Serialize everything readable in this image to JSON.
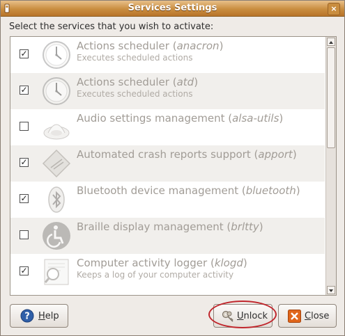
{
  "window": {
    "title": "Services Settings",
    "close_glyph": "×"
  },
  "prompt": "Select the services that you wish to activate:",
  "services": [
    {
      "name": "Actions scheduler (",
      "pkg": "anacron",
      "tail": ")",
      "desc": "Executes scheduled actions",
      "checked": true,
      "icon": "clock-icon"
    },
    {
      "name": "Actions scheduler (",
      "pkg": "atd",
      "tail": ")",
      "desc": "Executes scheduled actions",
      "checked": true,
      "icon": "clock-icon"
    },
    {
      "name": "Audio settings management (",
      "pkg": "alsa-utils",
      "tail": ")",
      "desc": "",
      "checked": false,
      "icon": "speaker-icon"
    },
    {
      "name": "Automated crash reports support (",
      "pkg": "apport",
      "tail": ")",
      "desc": "",
      "checked": true,
      "icon": "crash-report-icon"
    },
    {
      "name": "Bluetooth device management (",
      "pkg": "bluetooth",
      "tail": ")",
      "desc": "",
      "checked": true,
      "icon": "bluetooth-icon"
    },
    {
      "name": "Braille display management (",
      "pkg": "brltty",
      "tail": ")",
      "desc": "",
      "checked": false,
      "icon": "accessibility-icon"
    },
    {
      "name": "Computer activity logger (",
      "pkg": "klogd",
      "tail": ")",
      "desc": "Keeps a log of your computer activity",
      "checked": true,
      "icon": "log-viewer-icon"
    }
  ],
  "buttons": {
    "help_prefix": "",
    "help_mnemonic": "H",
    "help_rest": "elp",
    "unlock_mnemonic": "U",
    "unlock_rest": "nlock",
    "close_mnemonic": "C",
    "close_rest": "lose"
  },
  "colors": {
    "titlebar": "#c98d3f",
    "highlight_ring": "#c0262c",
    "help_blue": "#2f5fa8",
    "close_orange": "#e0661b"
  }
}
